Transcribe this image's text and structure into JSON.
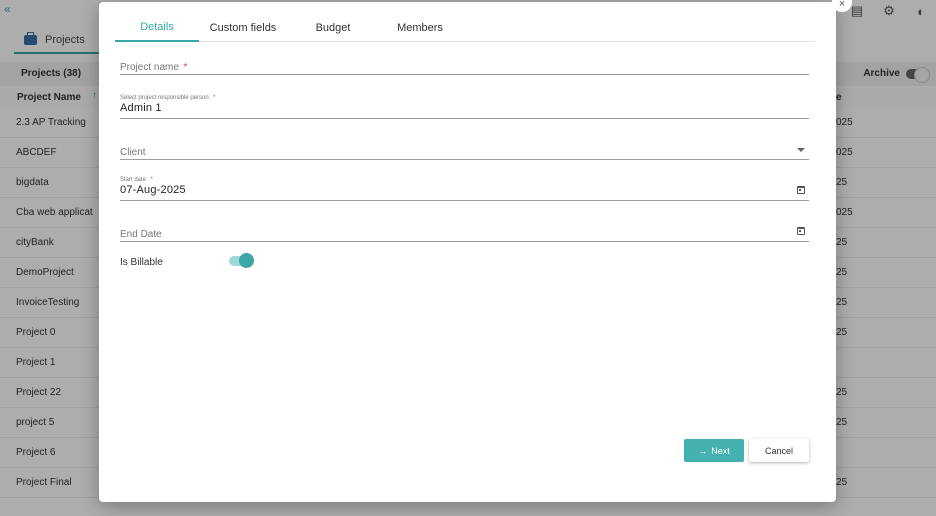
{
  "background": {
    "collapse_icon": "«",
    "projects_tab": "Projects",
    "list_title": "Projects  (38)",
    "archive_label": "Archive",
    "column_name": "Project Name",
    "sort_icon": "↑",
    "column_right_partial": "e",
    "rows": [
      {
        "name": "2.3 AP Tracking",
        "date": "025"
      },
      {
        "name": "ABCDEF",
        "date": "025"
      },
      {
        "name": "bigdata",
        "date": "25"
      },
      {
        "name": "Cba web applicat",
        "date": "025"
      },
      {
        "name": "cityBank",
        "date": "25"
      },
      {
        "name": "DemoProject",
        "date": "25"
      },
      {
        "name": "InvoiceTesting",
        "date": "25"
      },
      {
        "name": "Project 0",
        "date": "25"
      },
      {
        "name": "Project 1",
        "date": ""
      },
      {
        "name": "Project 22",
        "date": "25"
      },
      {
        "name": "project 5",
        "date": "25"
      },
      {
        "name": "Project 6",
        "date": ""
      },
      {
        "name": "Project Final",
        "date": "25"
      }
    ]
  },
  "dialog": {
    "close_icon": "×",
    "tabs": [
      {
        "label": "Details"
      },
      {
        "label": "Custom fields"
      },
      {
        "label": "Budget"
      },
      {
        "label": "Members"
      }
    ],
    "project_name": {
      "placeholder": "Project name",
      "required": "*"
    },
    "responsible": {
      "label": "Select project responsible person",
      "required": "*",
      "value": "Admin 1"
    },
    "client": {
      "placeholder": "Client"
    },
    "start_date": {
      "label": "Start date",
      "required": "*",
      "value": "07-Aug-2025"
    },
    "end_date": {
      "placeholder": "End Date"
    },
    "billable_label": "Is Billable",
    "next_label": "Next",
    "next_icon": "→",
    "cancel_label": "Cancel"
  },
  "colors": {
    "accent": "#3aa6a6",
    "required": "#e53935"
  }
}
